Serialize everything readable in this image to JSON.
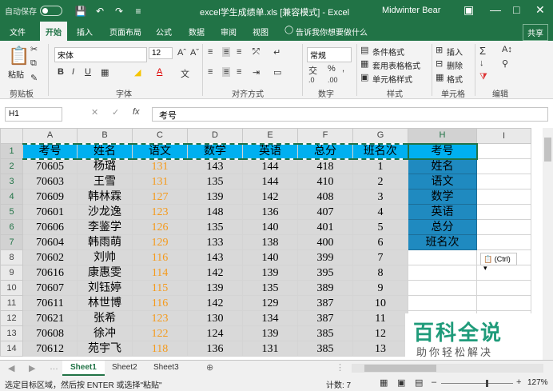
{
  "titlebar": {
    "autosave": "自动保存",
    "toggle": "关",
    "document": "excel学生成绩单.xls  [兼容模式]  -  Excel",
    "user": "Midwinter Bear"
  },
  "tabs": [
    "文件",
    "开始",
    "插入",
    "页面布局",
    "公式",
    "数据",
    "审阅",
    "视图"
  ],
  "tell_me": "告诉我你想要做什么",
  "share": "共享",
  "ribbon": {
    "paste": "粘贴",
    "clipboard": "剪贴板",
    "font_name": "宋体",
    "font_size": "12",
    "font_group": "字体",
    "alignment_group": "对齐方式",
    "number_format": "常规",
    "number_group": "数字",
    "conditional": "条件格式",
    "table_format": "套用表格格式",
    "cell_style": "单元格样式",
    "styles_group": "样式",
    "insert": "插入",
    "delete": "删除",
    "format": "格式",
    "cells_group": "单元格",
    "editing_group": "编辑"
  },
  "formula": {
    "namebox": "H1",
    "content": "考号"
  },
  "sheet": {
    "columns": [
      "A",
      "B",
      "C",
      "D",
      "E",
      "F",
      "G",
      "H",
      "I"
    ],
    "header": [
      "考号",
      "姓名",
      "语文",
      "数学",
      "英语",
      "总分",
      "班名次"
    ],
    "rows": [
      [
        "70605",
        "杨璐",
        "131",
        "143",
        "144",
        "418",
        "1"
      ],
      [
        "70603",
        "王雪",
        "131",
        "135",
        "144",
        "410",
        "2"
      ],
      [
        "70609",
        "韩林霖",
        "127",
        "139",
        "142",
        "408",
        "3"
      ],
      [
        "70601",
        "沙龙逸",
        "123",
        "148",
        "136",
        "407",
        "4"
      ],
      [
        "70606",
        "李鉴学",
        "126",
        "135",
        "140",
        "401",
        "5"
      ],
      [
        "70604",
        "韩雨萌",
        "129",
        "133",
        "138",
        "400",
        "6"
      ],
      [
        "70602",
        "刘帅",
        "116",
        "143",
        "140",
        "399",
        "7"
      ],
      [
        "70616",
        "康惠雯",
        "114",
        "142",
        "139",
        "395",
        "8"
      ],
      [
        "70607",
        "刘钰婷",
        "115",
        "139",
        "135",
        "389",
        "9"
      ],
      [
        "70611",
        "林世博",
        "116",
        "142",
        "129",
        "387",
        "10"
      ],
      [
        "70621",
        "张希",
        "123",
        "130",
        "134",
        "387",
        "11"
      ],
      [
        "70608",
        "徐冲",
        "122",
        "124",
        "139",
        "385",
        "12"
      ],
      [
        "70612",
        "苑宇飞",
        "118",
        "136",
        "131",
        "385",
        "13"
      ]
    ],
    "pasted": [
      "考号",
      "姓名",
      "语文",
      "数学",
      "英语",
      "总分",
      "班名次"
    ],
    "paste_tag": "(Ctrl)"
  },
  "watermark": {
    "title": "百科全说",
    "subtitle": "助你轻松解决"
  },
  "sheet_tabs": [
    "Sheet1",
    "Sheet2",
    "Sheet3"
  ],
  "status": {
    "message": "选定目标区域，然后按 ENTER 或选择\"粘贴\"",
    "count": "计数: 7",
    "zoom": "127%"
  }
}
